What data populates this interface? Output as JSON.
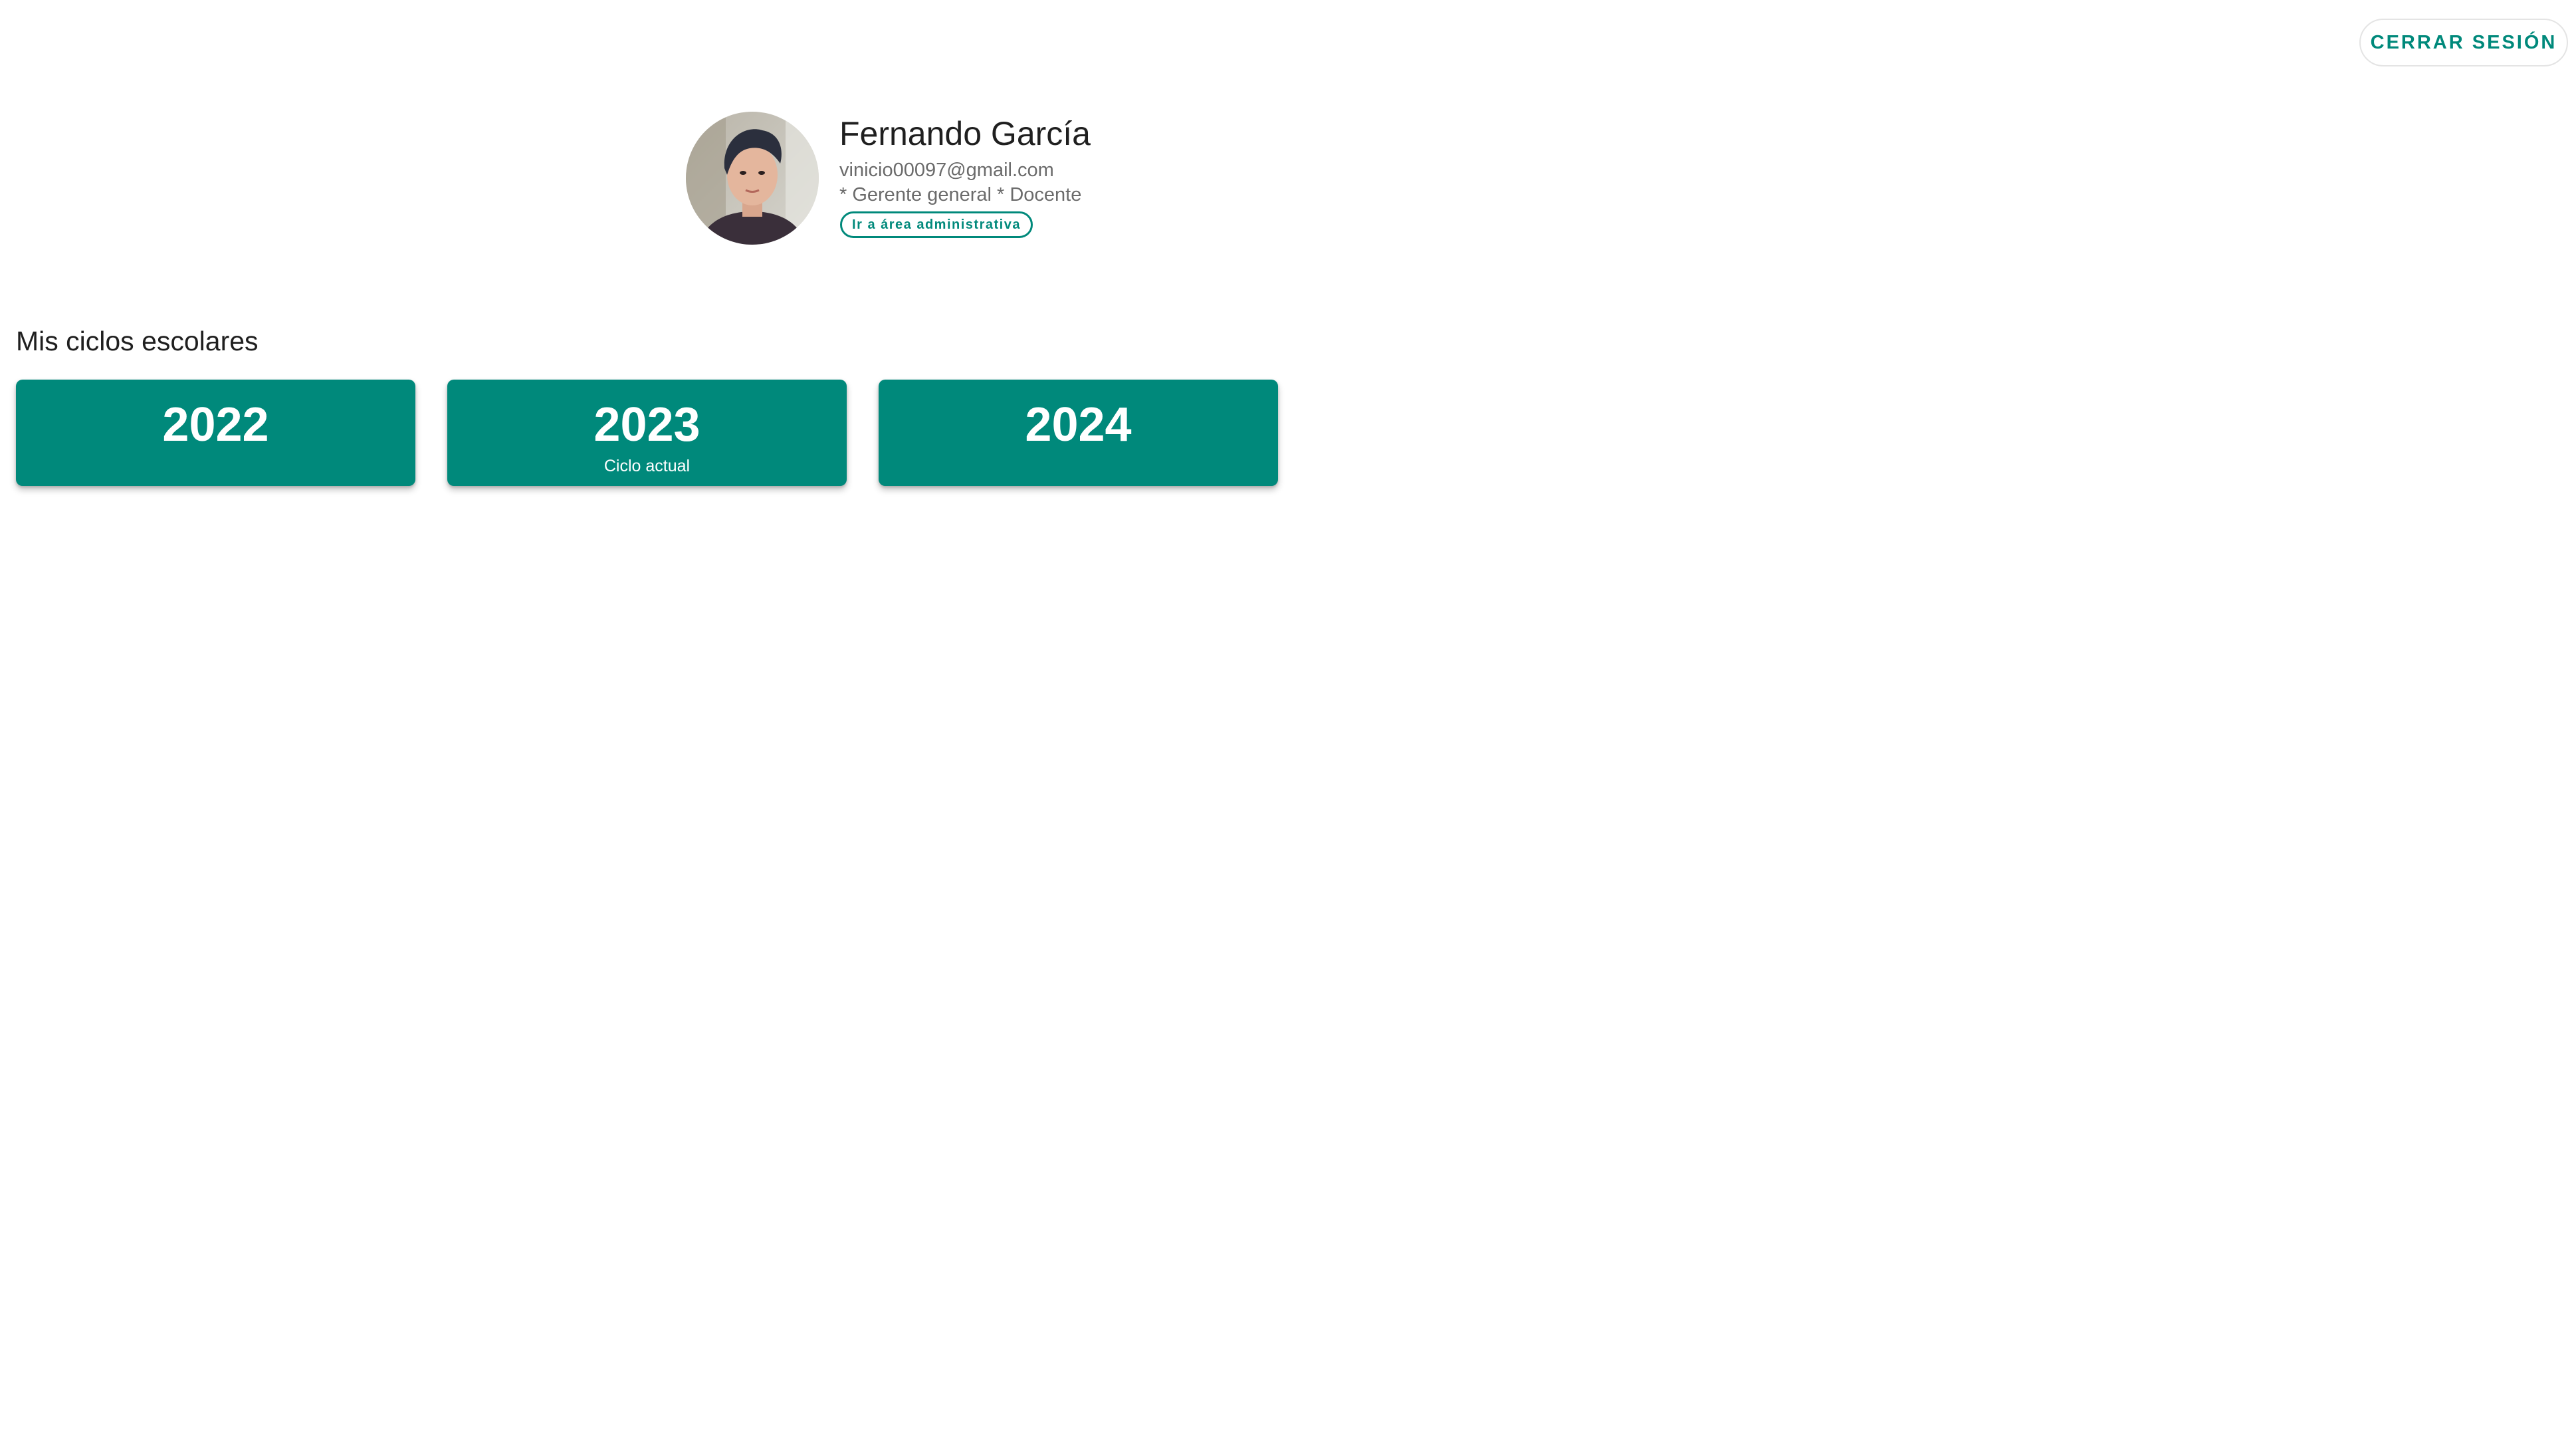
{
  "header": {
    "logout_label": "CERRAR SESIÓN"
  },
  "profile": {
    "name": "Fernando García",
    "email": "vinicio00097@gmail.com",
    "roles": "* Gerente general * Docente",
    "admin_link_label": "Ir a área administrativa"
  },
  "cycles": {
    "title": "Mis ciclos escolares",
    "items": [
      {
        "year": "2022",
        "subtitle": ""
      },
      {
        "year": "2023",
        "subtitle": "Ciclo actual"
      },
      {
        "year": "2024",
        "subtitle": ""
      }
    ]
  },
  "colors": {
    "accent": "#00897b",
    "text_primary": "#1f1f1f",
    "text_secondary": "#6b6b6b"
  }
}
